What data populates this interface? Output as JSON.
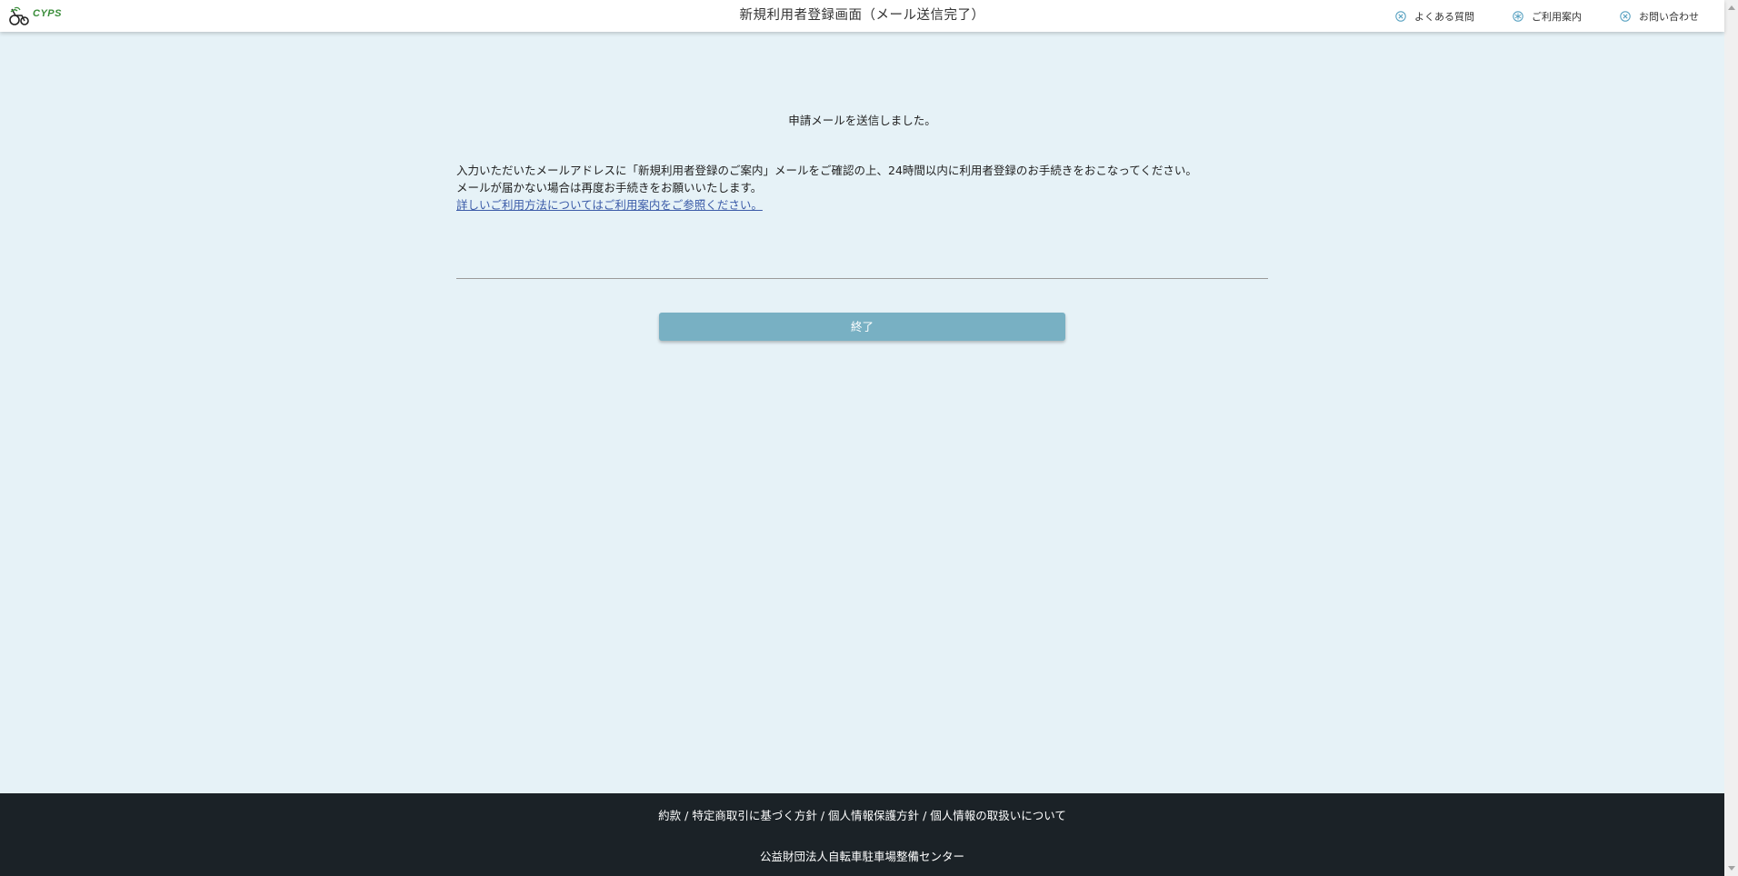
{
  "header": {
    "logo_text": "CYPS",
    "title": "新規利用者登録画面（メール送信完了）",
    "links": [
      {
        "label": "よくある質問",
        "icon": "close-circle-icon"
      },
      {
        "label": "ご利用案内",
        "icon": "snowflake-icon"
      },
      {
        "label": "お問い合わせ",
        "icon": "close-circle-icon"
      }
    ]
  },
  "main": {
    "sent_message": "申請メールを送信しました。",
    "line1": "入力いただいたメールアドレスに「新規利用者登録のご案内」メールをご確認の上、24時間以内に利用者登録のお手続きをおこなってください。",
    "line2": "メールが届かない場合は再度お手続きをお願いいたします。",
    "help_link": "詳しいご利用方法についてはご利用案内をご参照ください。",
    "finish_button": "終了"
  },
  "footer": {
    "links": [
      "約款",
      "特定商取引に基づく方針",
      "個人情報保護方針",
      "個人情報の取扱いについて"
    ],
    "separator": "/",
    "organization": "公益財団法人自転車駐車場整備センター"
  },
  "colors": {
    "background": "#e6f2f7",
    "button": "#78b0c3",
    "footer": "#1b2227",
    "link": "#3b5ba8",
    "icon": "#5ba3c2"
  }
}
